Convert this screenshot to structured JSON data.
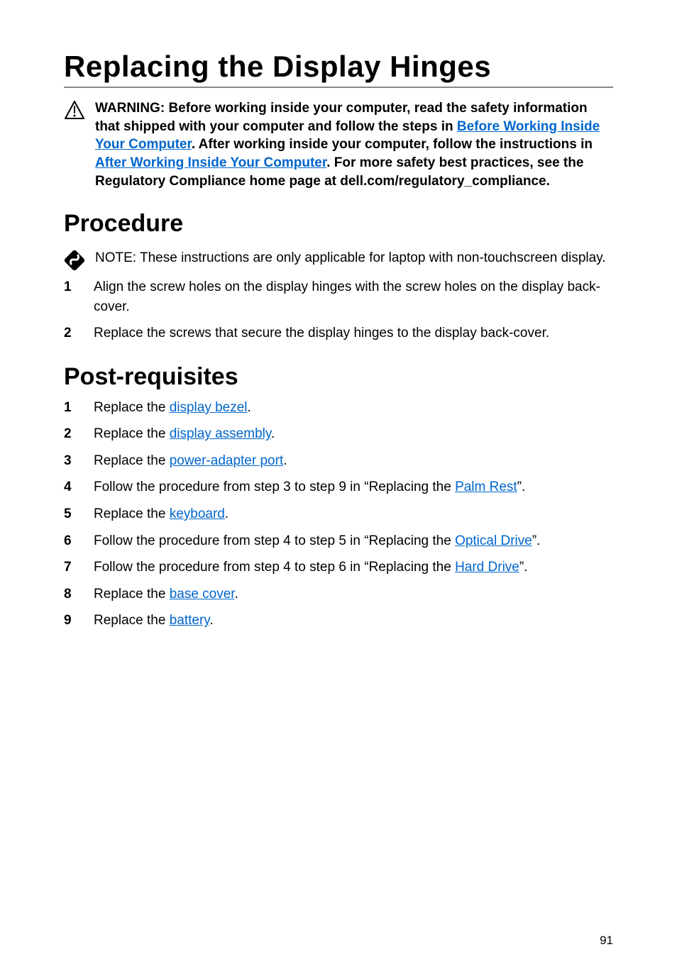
{
  "title": "Replacing the Display Hinges",
  "warning": {
    "label": "WARNING:",
    "t1": "Before working inside your computer, read the safety information that shipped with your computer and follow the steps in ",
    "link1": "Before Working Inside Your Computer",
    "t2": ". After working inside your computer, follow the instructions in ",
    "link2": "After Working Inside Your Computer",
    "t3": ". For more safety best practices, see the Regulatory Compliance home page at dell.com/regulatory_compliance."
  },
  "procedure": {
    "heading": "Procedure",
    "note": {
      "label": "NOTE:",
      "text": " These instructions are only applicable for laptop with non-touchscreen display."
    },
    "steps": [
      "Align the screw holes on the display hinges with the screw holes on the display back-cover.",
      "Replace the screws that secure the display hinges to the display back-cover."
    ]
  },
  "post": {
    "heading": "Post-requisites",
    "steps": [
      {
        "pre": "Replace the ",
        "link": "display bezel",
        "post": "."
      },
      {
        "pre": "Replace the ",
        "link": "display assembly",
        "post": "."
      },
      {
        "pre": "Replace the ",
        "link": "power-adapter port",
        "post": "."
      },
      {
        "pre": "Follow the procedure from step 3 to step 9 in “Replacing the ",
        "link": "Palm Rest",
        "post": "”."
      },
      {
        "pre": "Replace the ",
        "link": "keyboard",
        "post": "."
      },
      {
        "pre": "Follow the procedure from step 4 to step 5 in “Replacing the ",
        "link": "Optical Drive",
        "post": "”."
      },
      {
        "pre": "Follow the procedure from step 4 to step 6 in “Replacing the ",
        "link": "Hard Drive",
        "post": "”."
      },
      {
        "pre": "Replace the ",
        "link": "base cover",
        "post": "."
      },
      {
        "pre": "Replace the ",
        "link": "battery",
        "post": "."
      }
    ]
  },
  "page_number": "91"
}
